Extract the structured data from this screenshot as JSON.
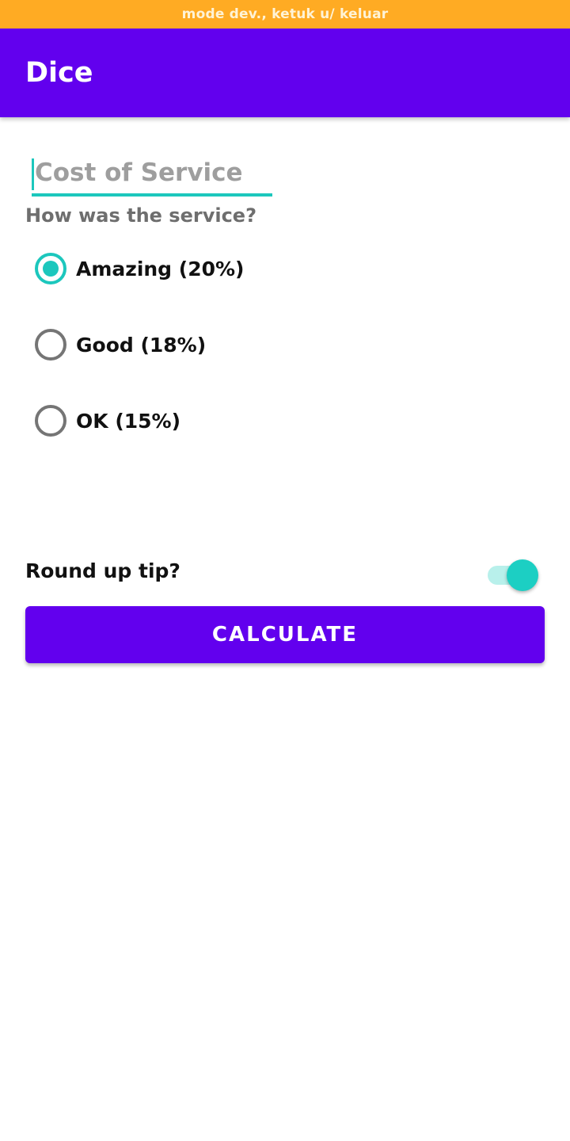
{
  "system": {
    "dev_mode_banner": "mode dev., ketuk u/ keluar"
  },
  "app_bar": {
    "title": "Dice"
  },
  "form": {
    "cost": {
      "value": "",
      "placeholder": "Cost of Service"
    },
    "service_question": "How was the service?",
    "service_options": [
      {
        "label": "Amazing (20%)",
        "selected": true
      },
      {
        "label": "Good (18%)",
        "selected": false
      },
      {
        "label": "OK (15%)",
        "selected": false
      }
    ],
    "round_up": {
      "label": "Round up tip?",
      "enabled": true
    },
    "calculate_label": "CALCULATE"
  },
  "colors": {
    "status_bar": "#FFAB23",
    "primary": "#6200EE",
    "accent": "#1CC7BD",
    "unselected_radio": "#757575"
  }
}
